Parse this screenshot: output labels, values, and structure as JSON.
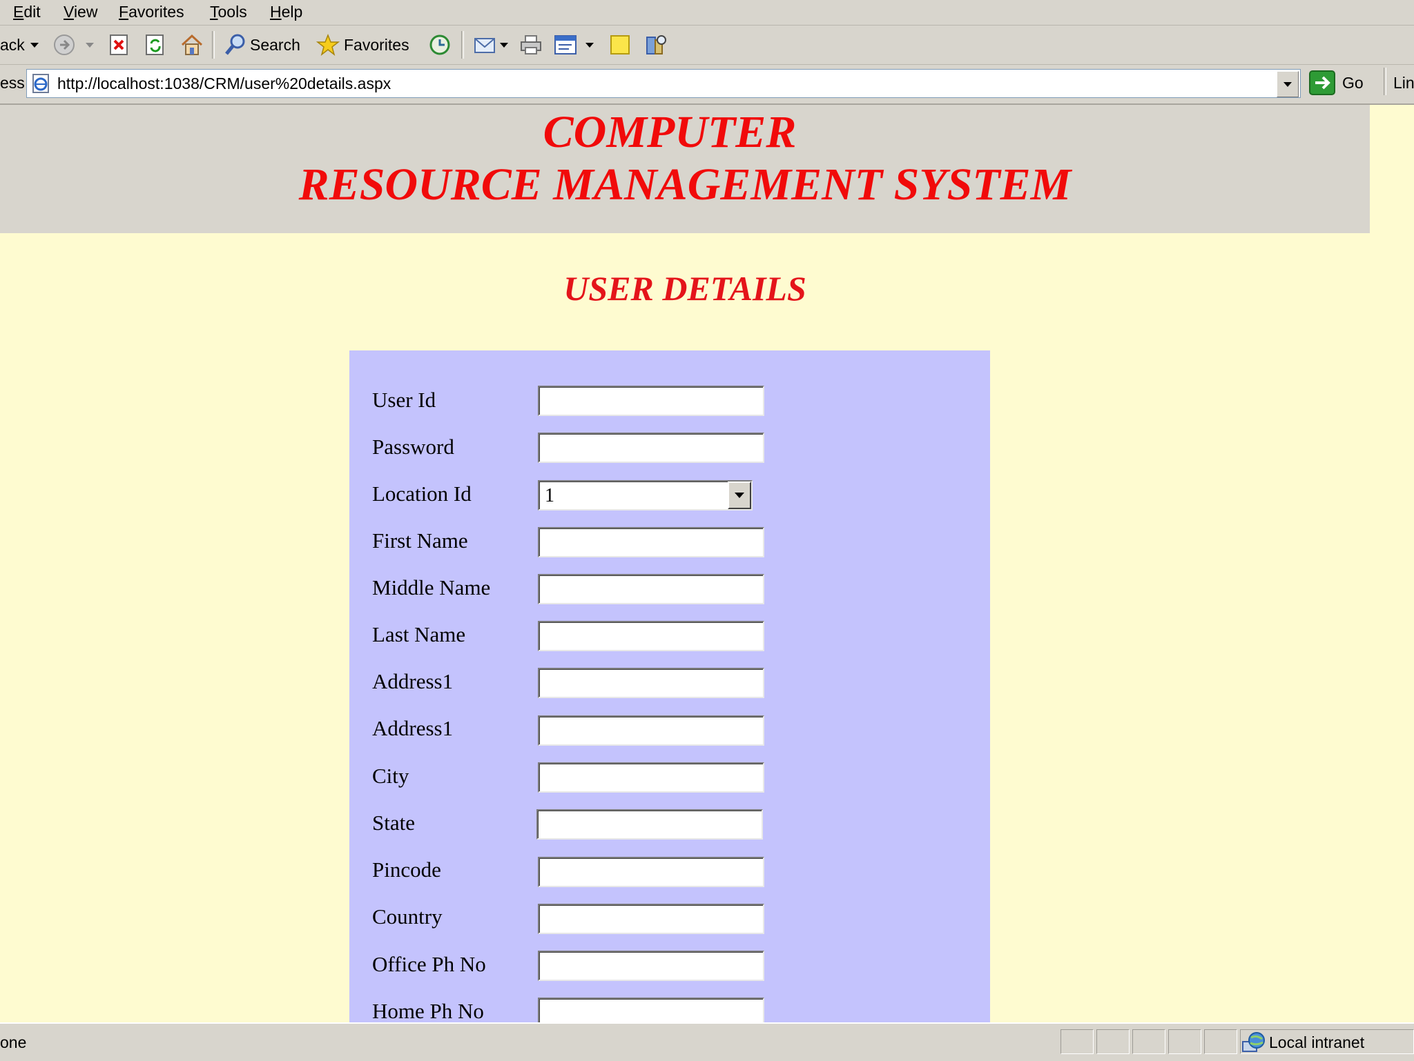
{
  "menubar": {
    "items": [
      "Edit",
      "View",
      "Favorites",
      "Tools",
      "Help"
    ]
  },
  "toolbar": {
    "back_label": "ack",
    "search_label": "Search",
    "favorites_label": "Favorites"
  },
  "addressbar": {
    "label": "ess",
    "url": "http://localhost:1038/CRM/user%20details.aspx",
    "go_label": "Go",
    "links_label": "Lin"
  },
  "page": {
    "banner_line1": "COMPUTER",
    "banner_line2": "RESOURCE MANAGEMENT SYSTEM",
    "section_title": "USER DETAILS",
    "colors": {
      "banner_text": "#f10a0a",
      "page_bg": "#fefbd0",
      "form_bg": "#c4c3fd"
    }
  },
  "form": {
    "fields": [
      {
        "label": "User Id",
        "value": ""
      },
      {
        "label": "Password",
        "value": ""
      },
      {
        "label": "Location Id",
        "value": "1",
        "type": "select"
      },
      {
        "label": "First Name",
        "value": ""
      },
      {
        "label": "Middle Name",
        "value": ""
      },
      {
        "label": "Last Name",
        "value": ""
      },
      {
        "label": "Address1",
        "value": ""
      },
      {
        "label": "Address1",
        "value": ""
      },
      {
        "label": "City",
        "value": ""
      },
      {
        "label": "State",
        "value": ""
      },
      {
        "label": "Pincode",
        "value": ""
      },
      {
        "label": "Country",
        "value": ""
      },
      {
        "label": "Office Ph No",
        "value": ""
      },
      {
        "label": "Home Ph No",
        "value": ""
      }
    ]
  },
  "statusbar": {
    "status_text": "one",
    "zone_label": "Local intranet"
  }
}
